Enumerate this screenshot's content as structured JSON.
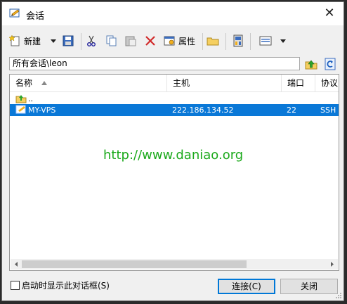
{
  "window": {
    "title": "会话",
    "close_glyph": "✕"
  },
  "toolbar": {
    "new_label": "新建",
    "properties_label": "属性",
    "icons": [
      "new-session-icon",
      "dropdown-arrow-icon",
      "save-icon",
      "cut-icon",
      "copy-icon",
      "paste-icon",
      "delete-icon",
      "properties-icon",
      "folder-icon",
      "connect-icon",
      "view-icon",
      "view-dropdown-icon"
    ]
  },
  "path": {
    "value": "所有会话\\leon"
  },
  "list": {
    "columns": [
      "名称",
      "主机",
      "端口",
      "协议"
    ],
    "parent_row": {
      "name": ".."
    },
    "rows": [
      {
        "name": "MY-VPS",
        "host": "222.186.134.52",
        "port": "22",
        "protocol": "SSH",
        "selected": true
      }
    ]
  },
  "watermark": "http://www.daniao.org",
  "footer": {
    "checkbox_label": "启动时显示此对话框(S)",
    "checkbox_checked": false,
    "connect_label": "连接(C)",
    "close_label": "关闭"
  },
  "colors": {
    "selection": "#0a78d7",
    "watermark": "#1ba91b",
    "accent": "#0078d7"
  }
}
